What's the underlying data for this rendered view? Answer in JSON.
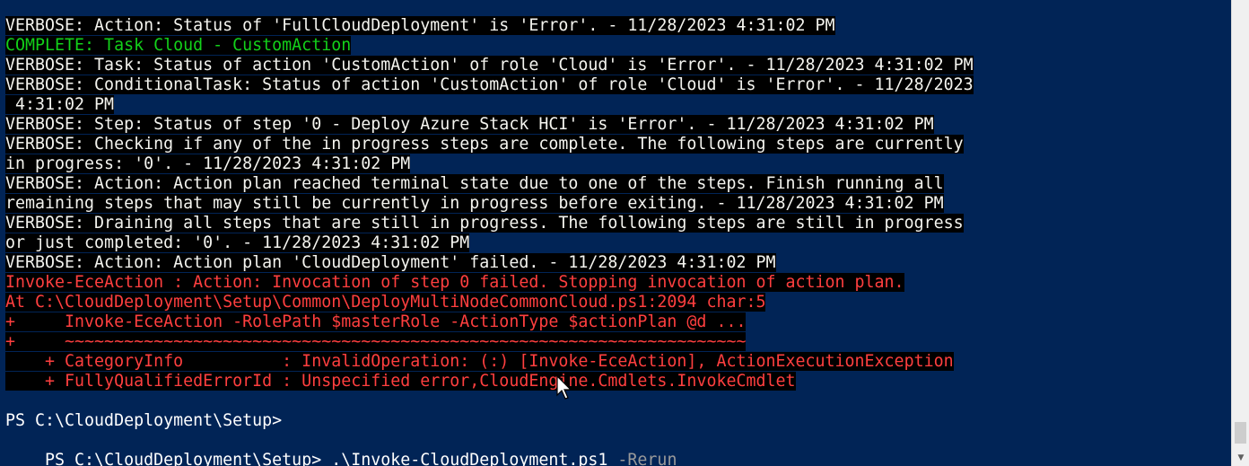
{
  "console": {
    "lines": [
      {
        "kind": "verbose",
        "text": "VERBOSE: Action: Status of 'FullCloudDeployment' is 'Error'. - 11/28/2023 4:31:02 PM"
      },
      {
        "kind": "complete",
        "text": "COMPLETE: Task Cloud - CustomAction"
      },
      {
        "kind": "verbose",
        "text": "VERBOSE: Task: Status of action 'CustomAction' of role 'Cloud' is 'Error'. - 11/28/2023 4:31:02 PM"
      },
      {
        "kind": "verbose",
        "text": "VERBOSE: ConditionalTask: Status of action 'CustomAction' of role 'Cloud' is 'Error'. - 11/28/2023"
      },
      {
        "kind": "verbose",
        "text": " 4:31:02 PM"
      },
      {
        "kind": "verbose",
        "text": "VERBOSE: Step: Status of step '0 - Deploy Azure Stack HCI' is 'Error'. - 11/28/2023 4:31:02 PM"
      },
      {
        "kind": "verbose",
        "text": "VERBOSE: Checking if any of the in progress steps are complete. The following steps are currently"
      },
      {
        "kind": "verbose",
        "text": "in progress: '0'. - 11/28/2023 4:31:02 PM"
      },
      {
        "kind": "verbose",
        "text": "VERBOSE: Action: Action plan reached terminal state due to one of the steps. Finish running all"
      },
      {
        "kind": "verbose",
        "text": "remaining steps that may still be currently in progress before exiting. - 11/28/2023 4:31:02 PM"
      },
      {
        "kind": "verbose",
        "text": "VERBOSE: Draining all steps that are still in progress. The following steps are still in progress"
      },
      {
        "kind": "verbose",
        "text": "or just completed: '0'. - 11/28/2023 4:31:02 PM"
      },
      {
        "kind": "verbose",
        "text": "VERBOSE: Action: Action plan 'CloudDeployment' failed. - 11/28/2023 4:31:02 PM"
      },
      {
        "kind": "error",
        "text": "Invoke-EceAction : Action: Invocation of step 0 failed. Stopping invocation of action plan."
      },
      {
        "kind": "error",
        "text": "At C:\\CloudDeployment\\Setup\\Common\\DeployMultiNodeCommonCloud.ps1:2094 char:5"
      },
      {
        "kind": "error",
        "text": "+     Invoke-EceAction -RolePath $masterRole -ActionType $actionPlan @d ..."
      },
      {
        "kind": "error",
        "text": "+     ~~~~~~~~~~~~~~~~~~~~~~~~~~~~~~~~~~~~~~~~~~~~~~~~~~~~~~~~~~~~~~~~~~~~~"
      },
      {
        "kind": "error",
        "text": "    + CategoryInfo          : InvalidOperation: (:) [Invoke-EceAction], ActionExecutionException"
      },
      {
        "kind": "error",
        "text": "    + FullyQualifiedErrorId : Unspecified error,CloudEngine.Cmdlets.InvokeCmdlet"
      },
      {
        "kind": "blank",
        "text": ""
      },
      {
        "kind": "prompt",
        "text": "PS C:\\CloudDeployment\\Setup>"
      }
    ],
    "current_input": {
      "prompt": "PS C:\\CloudDeployment\\Setup> ",
      "command": ".\\Invoke-CloudDeployment.ps1",
      "parameter": " -Rerun"
    }
  },
  "colors": {
    "background": "#012456",
    "verbose_text": "#f4f4ef",
    "verbose_highlight": "#000000",
    "complete_text": "#13d11a",
    "error_text": "#ff3f3f",
    "parameter_text": "#9a9a9a"
  },
  "icons": {
    "scroll_up": "triangle-up-icon",
    "scroll_down": "triangle-down-icon",
    "mouse_pointer": "mouse-pointer-icon"
  }
}
